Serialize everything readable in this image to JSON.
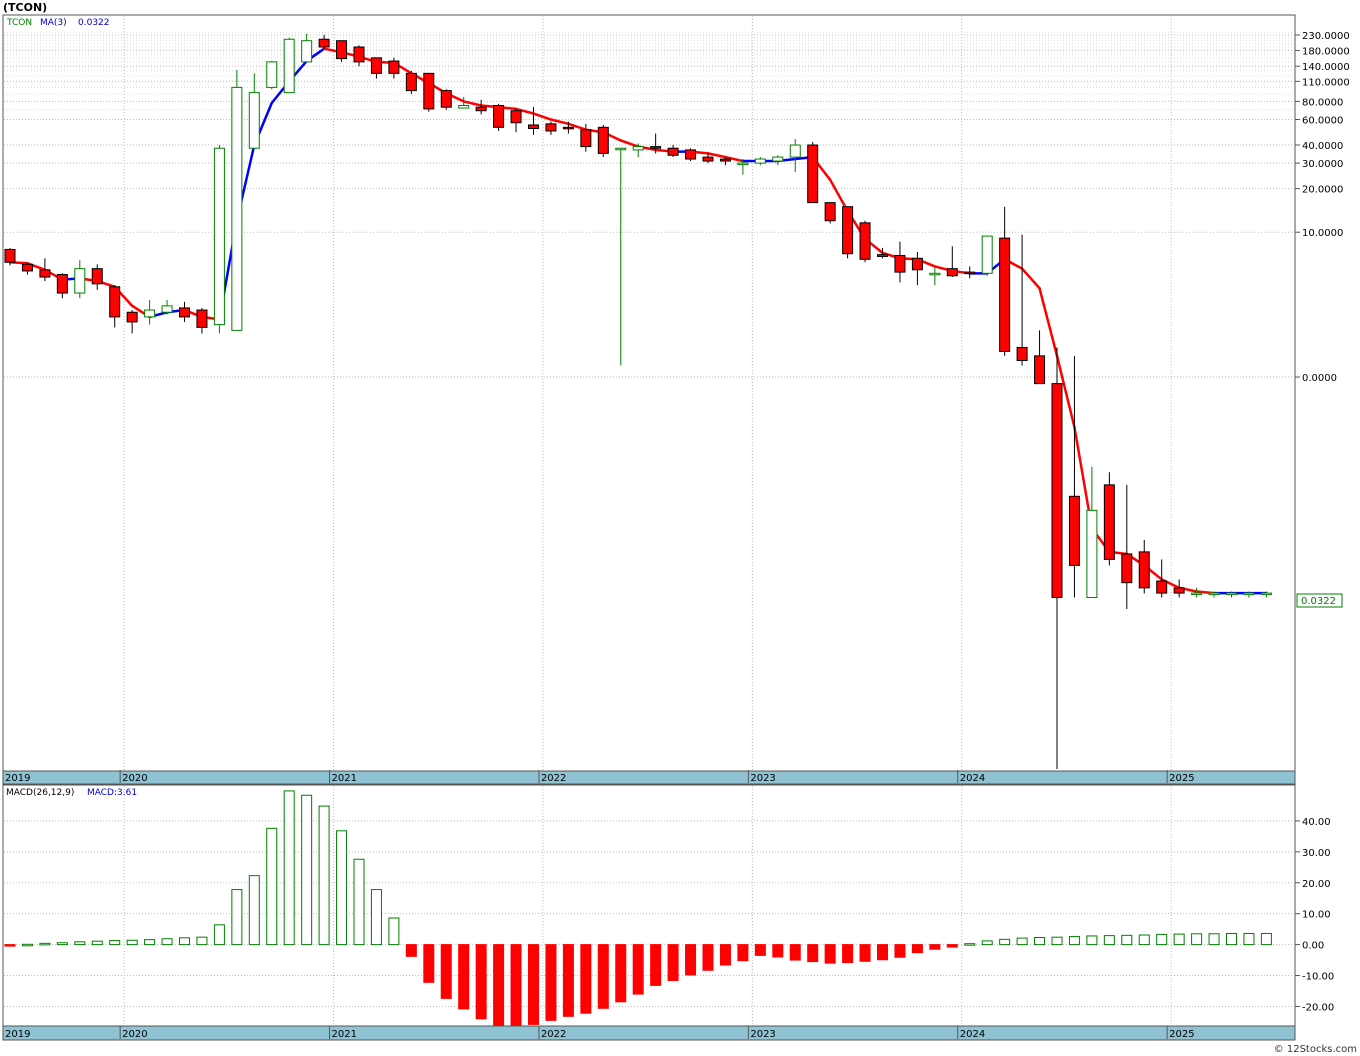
{
  "title": "(TCON)",
  "watermark": "© 12Stocks.com",
  "colors": {
    "up": "#008000",
    "down": "#ff0000",
    "ma_up": "#0000ff",
    "ma_down": "#ff0000",
    "axis_band": "#8fc3d4",
    "grid": "#bbbbbb",
    "last_label_text": "#008000"
  },
  "chart_data": [
    {
      "type": "candlestick",
      "legend": {
        "ticker": "TCON",
        "ma_label": "MA(3)",
        "ma_value": "0.0322"
      },
      "y_scale": "log",
      "y_ticks": [
        "230.0000",
        "180.0000",
        "140.0000",
        "110.0000",
        "80.0000",
        "60.0000",
        "40.0000",
        "30.0000",
        "20.0000",
        "10.0000",
        "0.0000"
      ],
      "y_tick_values": [
        230,
        180,
        140,
        110,
        80,
        60,
        40,
        30,
        20,
        10,
        1
      ],
      "last_label": "0.0322",
      "last_value": 0.0322,
      "x_labels": [
        "2019",
        "2020",
        "2021",
        "2022",
        "2023",
        "2024",
        "2025"
      ],
      "x_label_dates": [
        "2019-06",
        "2020-01",
        "2021-01",
        "2022-01",
        "2023-01",
        "2024-01",
        "2025-01"
      ],
      "dates": [
        "2019-06",
        "2019-07",
        "2019-08",
        "2019-09",
        "2019-10",
        "2019-11",
        "2019-12",
        "2020-01",
        "2020-02",
        "2020-03",
        "2020-04",
        "2020-05",
        "2020-06",
        "2020-07",
        "2020-08",
        "2020-09",
        "2020-10",
        "2020-11",
        "2020-12",
        "2021-01",
        "2021-02",
        "2021-03",
        "2021-04",
        "2021-05",
        "2021-06",
        "2021-07",
        "2021-08",
        "2021-09",
        "2021-10",
        "2021-11",
        "2021-12",
        "2022-01",
        "2022-02",
        "2022-03",
        "2022-04",
        "2022-05",
        "2022-06",
        "2022-07",
        "2022-08",
        "2022-09",
        "2022-10",
        "2022-11",
        "2022-12",
        "2023-01",
        "2023-02",
        "2023-03",
        "2023-04",
        "2023-05",
        "2023-06",
        "2023-07",
        "2023-08",
        "2023-09",
        "2023-10",
        "2023-11",
        "2023-12",
        "2024-01",
        "2024-02",
        "2024-03",
        "2024-04",
        "2024-05",
        "2024-06",
        "2024-07",
        "2024-08",
        "2024-09",
        "2024-10",
        "2024-11",
        "2024-12",
        "2025-01",
        "2025-02",
        "2025-03",
        "2025-04",
        "2025-05",
        "2025-06"
      ],
      "open": [
        7.6,
        6.0,
        5.5,
        5.1,
        3.8,
        5.6,
        4.2,
        2.8,
        2.6,
        2.8,
        3.0,
        2.9,
        2.3,
        2.1,
        38,
        100,
        92,
        150,
        215,
        210,
        190,
        160,
        152,
        125,
        125,
        95,
        72,
        73,
        75,
        69,
        55,
        56,
        53,
        51,
        53,
        38,
        37,
        39,
        38,
        37,
        33,
        32,
        30,
        30,
        31,
        33,
        40,
        16,
        15,
        11.6,
        7,
        6.9,
        6.6,
        5.2,
        5.6,
        5.3,
        5.2,
        9.1,
        1.6,
        1.4,
        0.9,
        0.15,
        0.03,
        0.18,
        0.06,
        0.062,
        0.039,
        0.035,
        0.0322,
        0.0322,
        0.0322,
        0.0322,
        0.0322
      ],
      "close": [
        6.2,
        5.4,
        4.9,
        3.8,
        5.6,
        4.4,
        2.6,
        2.4,
        2.9,
        3.1,
        2.6,
        2.2,
        38,
        100,
        92,
        150,
        215,
        210,
        190,
        158,
        150,
        125,
        125,
        95,
        71,
        73,
        75,
        69,
        53,
        57,
        52,
        50,
        52,
        39,
        35,
        38,
        39,
        38,
        34,
        32,
        31,
        31,
        30,
        32,
        33,
        40,
        16,
        12,
        7.1,
        6.5,
        6.8,
        5.3,
        5.5,
        5.2,
        5.0,
        5.2,
        9.4,
        1.5,
        1.3,
        0.9,
        0.03,
        0.05,
        0.12,
        0.055,
        0.038,
        0.035,
        0.0322,
        0.0322,
        0.0322,
        0.0322,
        0.0322,
        0.0322,
        0.0322
      ],
      "high": [
        7.8,
        6.2,
        6.6,
        5.2,
        6.4,
        6.0,
        4.3,
        2.9,
        3.4,
        3.4,
        3.3,
        3.0,
        40,
        132,
        125,
        152,
        220,
        235,
        230,
        205,
        195,
        160,
        160,
        130,
        125,
        97,
        86,
        82,
        77,
        71,
        73,
        58,
        58,
        56,
        55,
        38,
        41,
        48,
        40,
        38,
        35,
        33,
        32,
        33,
        34,
        44,
        42,
        16,
        15,
        12,
        7.8,
        8.6,
        7.3,
        5.7,
        8.0,
        5.8,
        5.6,
        15,
        9.6,
        2.1,
        1.6,
        1.4,
        0.24,
        0.22,
        0.18,
        0.075,
        0.055,
        0.04,
        0.035,
        0.033,
        0.033,
        0.033,
        0.033
      ],
      "low": [
        5.9,
        5.1,
        4.6,
        3.5,
        3.5,
        4.0,
        2.2,
        2.0,
        2.3,
        2.7,
        2.4,
        2.0,
        2.0,
        39,
        90,
        97,
        140,
        200,
        185,
        150,
        140,
        115,
        115,
        90,
        68,
        70,
        72,
        65,
        50,
        49,
        47,
        47,
        48,
        36,
        33,
        1.2,
        33,
        35,
        33,
        31,
        30,
        29,
        25,
        29,
        29,
        26,
        16,
        11.5,
        6.6,
        6.2,
        6.6,
        4.5,
        4.3,
        4.3,
        4.9,
        4.8,
        5.0,
        1.4,
        1.2,
        0.9,
        0.0,
        0.03,
        0.03,
        0.05,
        0.025,
        0.032,
        0.03,
        0.03,
        0.03,
        0.03,
        0.03,
        0.03,
        0.03
      ],
      "ma": [
        6.2,
        6.1,
        5.5,
        4.7,
        4.8,
        4.6,
        4.2,
        3.1,
        2.6,
        2.8,
        2.9,
        2.6,
        2.5,
        12,
        40,
        78,
        110,
        152,
        185,
        175,
        163,
        150,
        148,
        125,
        107,
        91,
        80,
        75,
        73,
        71,
        66,
        60,
        56,
        51,
        49,
        43,
        39,
        37,
        36,
        36,
        35,
        33,
        31,
        31,
        31,
        32,
        33,
        23,
        14,
        9,
        7.2,
        6.6,
        6.5,
        5.8,
        5.4,
        5.2,
        5.2,
        6.5,
        5.6,
        4.1,
        1.4,
        0.45,
        0.09,
        0.062,
        0.06,
        0.05,
        0.04,
        0.035,
        0.033,
        0.0322,
        0.0322,
        0.0322,
        0.0322
      ]
    },
    {
      "type": "bar",
      "legend": {
        "name": "MACD(26,12,9)",
        "value_label": "MACD:3.61"
      },
      "y_ticks": [
        "40.00",
        "30.00",
        "20.00",
        "10.00",
        "0.00",
        "-10.00",
        "-20.00"
      ],
      "y_tick_values": [
        40,
        30,
        20,
        10,
        0,
        -10,
        -20
      ],
      "x_labels": [
        "2019",
        "2020",
        "2021",
        "2022",
        "2023",
        "2024",
        "2025"
      ],
      "ylim": [
        -26,
        50
      ],
      "values": [
        -0.2,
        0.1,
        0.4,
        0.6,
        0.9,
        1.1,
        1.3,
        1.4,
        1.6,
        1.9,
        2.2,
        2.4,
        6.4,
        17.8,
        22.3,
        37.6,
        49.7,
        48.3,
        44.8,
        36.8,
        27.6,
        17.8,
        8.6,
        -3.8,
        -12.2,
        -17.4,
        -20.8,
        -24.0,
        -26.0,
        -26.5,
        -25.8,
        -24.5,
        -23.2,
        -22.2,
        -20.6,
        -18.5,
        -16.0,
        -13.2,
        -11.6,
        -9.8,
        -8.3,
        -6.6,
        -5.2,
        -3.5,
        -4.0,
        -5.0,
        -5.5,
        -6.0,
        -5.8,
        -5.4,
        -4.9,
        -4.1,
        -2.6,
        -1.5,
        -0.8,
        0.3,
        1.2,
        1.7,
        2.1,
        2.3,
        2.4,
        2.6,
        2.8,
        2.9,
        3.0,
        3.1,
        3.3,
        3.4,
        3.5,
        3.5,
        3.6,
        3.6,
        3.6
      ]
    }
  ]
}
